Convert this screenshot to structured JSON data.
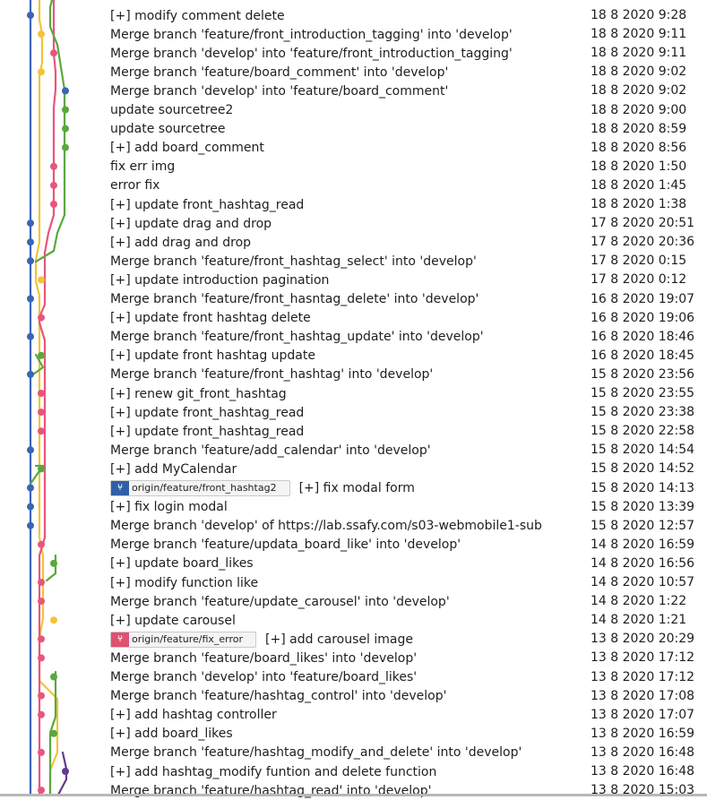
{
  "colors": {
    "blue": "#3a64b8",
    "yellow": "#f2c33a",
    "pink": "#e8557c",
    "green": "#5aa83d",
    "purple": "#5f3d8a"
  },
  "commits": [
    {
      "message": "[+] modify comment delete",
      "date": "18 8 2020 9:28"
    },
    {
      "message": "Merge branch 'feature/front_introduction_tagging' into 'develop'",
      "date": "18 8 2020 9:11"
    },
    {
      "message": "Merge branch 'develop' into 'feature/front_introduction_tagging'",
      "date": "18 8 2020 9:11"
    },
    {
      "message": "Merge branch 'feature/board_comment' into 'develop'",
      "date": "18 8 2020 9:02"
    },
    {
      "message": "Merge branch 'develop' into 'feature/board_comment'",
      "date": "18 8 2020 9:02"
    },
    {
      "message": "update sourcetree2",
      "date": "18 8 2020 9:00"
    },
    {
      "message": "update sourcetree",
      "date": "18 8 2020 8:59"
    },
    {
      "message": "[+] add board_comment",
      "date": "18 8 2020 8:56"
    },
    {
      "message": "fix err img",
      "date": "18 8 2020 1:50"
    },
    {
      "message": "error fix",
      "date": "18 8 2020 1:45"
    },
    {
      "message": "[+] update front_hashtag_read",
      "date": "18 8 2020 1:38"
    },
    {
      "message": "[+] update drag and drop",
      "date": "17 8 2020 20:51"
    },
    {
      "message": "[+] add drag and drop",
      "date": "17 8 2020 20:36"
    },
    {
      "message": "Merge branch 'feature/front_hashtag_select' into 'develop'",
      "date": "17 8 2020 0:15"
    },
    {
      "message": "[+] update introduction pagination",
      "date": "17 8 2020 0:12"
    },
    {
      "message": "Merge branch 'feature/front_hasntag_delete' into 'develop'",
      "date": "16 8 2020 19:07"
    },
    {
      "message": "[+] update front hashtag delete",
      "date": "16 8 2020 19:06"
    },
    {
      "message": "Merge branch 'feature/front_hashtag_update' into 'develop'",
      "date": "16 8 2020 18:46"
    },
    {
      "message": "[+] update front hashtag update",
      "date": "16 8 2020 18:45"
    },
    {
      "message": "Merge branch 'feature/front_hashtag' into 'develop'",
      "date": "15 8 2020 23:56"
    },
    {
      "message": "[+] renew git_front_hashtag",
      "date": "15 8 2020 23:55"
    },
    {
      "message": "[+] update front_hashtag_read",
      "date": "15 8 2020 23:38"
    },
    {
      "message": "[+] update front_hashtag_read",
      "date": "15 8 2020 22:58"
    },
    {
      "message": "Merge branch 'feature/add_calendar' into 'develop'",
      "date": "15 8 2020 14:54"
    },
    {
      "message": "[+] add MyCalendar",
      "date": "15 8 2020 14:52"
    },
    {
      "message": "[+] fix modal form",
      "date": "15 8 2020 14:13",
      "tag": {
        "label": "origin/feature/front_hashtag2",
        "color": "#2f5fa8"
      }
    },
    {
      "message": "[+] fix login modal",
      "date": "15 8 2020 13:39"
    },
    {
      "message": "Merge branch 'develop' of https://lab.ssafy.com/s03-webmobile1-sub",
      "date": "15 8 2020 12:57"
    },
    {
      "message": "Merge branch 'feature/updata_board_like' into 'develop'",
      "date": "14 8 2020 16:59"
    },
    {
      "message": "[+] update board_likes",
      "date": "14 8 2020 16:56"
    },
    {
      "message": "[+] modify function like",
      "date": "14 8 2020 10:57"
    },
    {
      "message": "Merge branch 'feature/update_carousel' into 'develop'",
      "date": "14 8 2020 1:22"
    },
    {
      "message": "[+] update carousel",
      "date": "14 8 2020 1:21"
    },
    {
      "message": "[+] add carousel image",
      "date": "13 8 2020 20:29",
      "tag": {
        "label": "origin/feature/fix_error",
        "color": "#e0506f"
      }
    },
    {
      "message": "Merge branch 'feature/board_likes' into 'develop'",
      "date": "13 8 2020 17:12"
    },
    {
      "message": "Merge branch 'develop' into 'feature/board_likes'",
      "date": "13 8 2020 17:12"
    },
    {
      "message": "Merge branch 'feature/hashtag_control' into 'develop'",
      "date": "13 8 2020 17:08"
    },
    {
      "message": "[+] add hashtag controller",
      "date": "13 8 2020 17:07"
    },
    {
      "message": "[+] add board_likes",
      "date": "13 8 2020 16:59"
    },
    {
      "message": "Merge branch 'feature/hashtag_modify_and_delete' into 'develop'",
      "date": "13 8 2020 16:48"
    },
    {
      "message": "[+] add hashtag_modify funtion and delete function",
      "date": "13 8 2020 16:48"
    },
    {
      "message": "Merge branch 'feature/hashtag_read' into 'develop'",
      "date": "13 8 2020 15:03"
    }
  ],
  "graph_dots": [
    {
      "lane": 0,
      "color": "blue"
    },
    {
      "lane": 1,
      "color": "yellow"
    },
    {
      "lane": 2,
      "color": "pink"
    },
    {
      "lane": 1,
      "color": "yellow"
    },
    {
      "lane": 3,
      "color": "blue"
    },
    {
      "lane": 3,
      "color": "green"
    },
    {
      "lane": 3,
      "color": "green"
    },
    {
      "lane": 3,
      "color": "green"
    },
    {
      "lane": 2,
      "color": "pink"
    },
    {
      "lane": 2,
      "color": "pink"
    },
    {
      "lane": 2,
      "color": "pink"
    },
    {
      "lane": 0,
      "color": "blue"
    },
    {
      "lane": 0,
      "color": "blue"
    },
    {
      "lane": 0,
      "color": "blue"
    },
    {
      "lane": 1,
      "color": "yellow"
    },
    {
      "lane": 0,
      "color": "blue"
    },
    {
      "lane": 1,
      "color": "pink"
    },
    {
      "lane": 0,
      "color": "blue"
    },
    {
      "lane": 1,
      "color": "green"
    },
    {
      "lane": 0,
      "color": "blue"
    },
    {
      "lane": 1,
      "color": "pink"
    },
    {
      "lane": 1,
      "color": "pink"
    },
    {
      "lane": 1,
      "color": "pink"
    },
    {
      "lane": 0,
      "color": "blue"
    },
    {
      "lane": 1,
      "color": "green"
    },
    {
      "lane": 0,
      "color": "blue"
    },
    {
      "lane": 0,
      "color": "blue"
    },
    {
      "lane": 0,
      "color": "blue"
    },
    {
      "lane": 1,
      "color": "pink"
    },
    {
      "lane": 2,
      "color": "green"
    },
    {
      "lane": 1,
      "color": "pink"
    },
    {
      "lane": 1,
      "color": "pink"
    },
    {
      "lane": 2,
      "color": "yellow"
    },
    {
      "lane": 1,
      "color": "pink"
    },
    {
      "lane": 1,
      "color": "pink"
    },
    {
      "lane": 2,
      "color": "green"
    },
    {
      "lane": 1,
      "color": "pink"
    },
    {
      "lane": 1,
      "color": "pink"
    },
    {
      "lane": 2,
      "color": "green"
    },
    {
      "lane": 1,
      "color": "pink"
    },
    {
      "lane": 3,
      "color": "purple"
    },
    {
      "lane": 1,
      "color": "pink"
    }
  ]
}
